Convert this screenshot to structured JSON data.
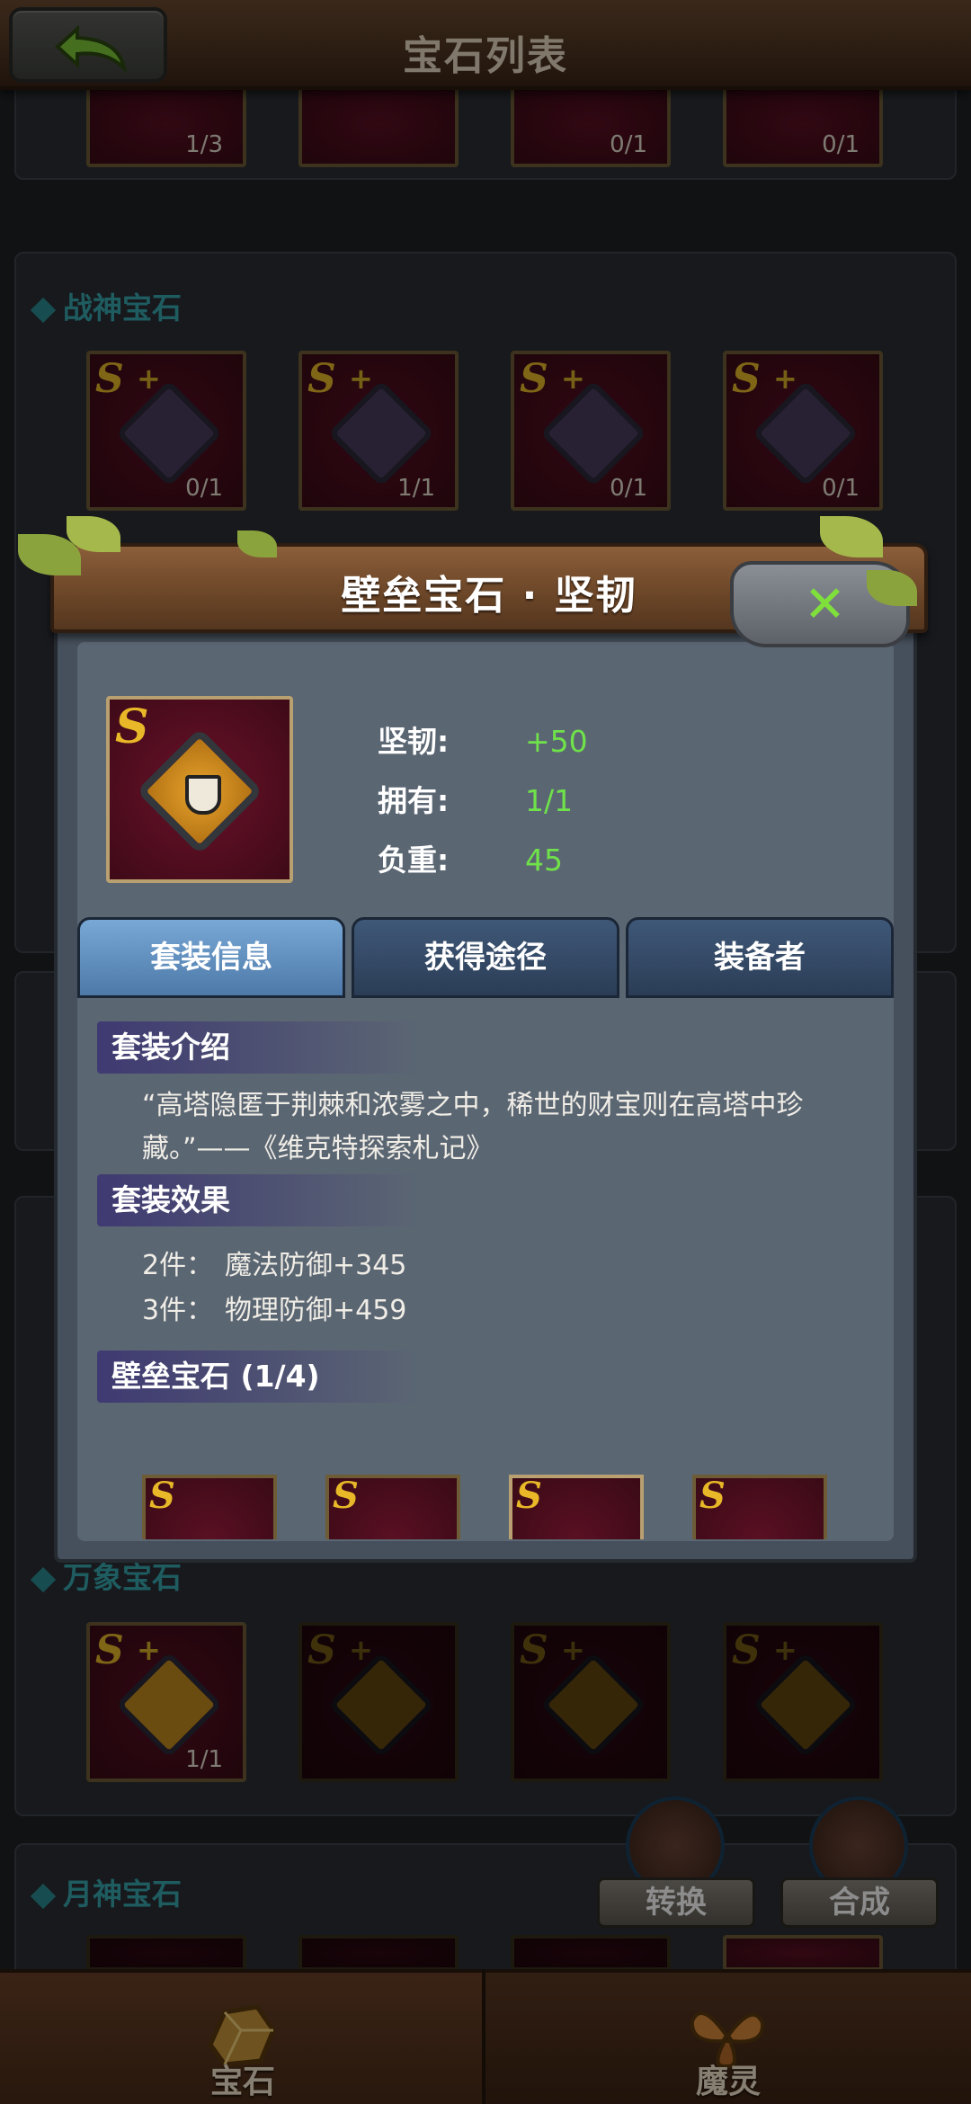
{
  "header": {
    "title": "宝石列表"
  },
  "background_sections": {
    "top_counts": [
      "1/3",
      "",
      "0/1",
      "0/1"
    ],
    "zhanshen": {
      "title": "战神宝石",
      "counts": [
        "0/1",
        "1/1",
        "0/1",
        "0/1"
      ]
    },
    "wanxiang": {
      "title": "万象宝石",
      "counts": [
        "1/1",
        "",
        "",
        ""
      ]
    },
    "yueshen": {
      "title": "月神宝石"
    }
  },
  "modal": {
    "title": "壁垒宝石 · 坚韧",
    "item": {
      "grade": "S"
    },
    "stats": [
      {
        "label": "坚韧:",
        "value": "+50"
      },
      {
        "label": "拥有:",
        "value": "1/1"
      },
      {
        "label": "负重:",
        "value": "45"
      }
    ],
    "tabs": [
      "套装信息",
      "获得途径",
      "装备者"
    ],
    "active_tab": 0,
    "set_intro": {
      "heading": "套装介绍",
      "text": "“高塔隐匿于荆棘和浓雾之中，稀世的财宝则在高塔中珍藏。”——《维克特探索札记》"
    },
    "set_effect": {
      "heading": "套装效果",
      "effects": [
        {
          "pieces": "2件：",
          "bonus": "魔法防御+345"
        },
        {
          "pieces": "3件：",
          "bonus": "物理防御+459"
        }
      ]
    },
    "set_members": {
      "heading": "壁垒宝石 (1/4)"
    }
  },
  "actions": {
    "convert": "转换",
    "synthesize": "合成"
  },
  "bottom_nav": {
    "items": [
      "宝石",
      "魔灵"
    ],
    "active": 0
  },
  "colors": {
    "stat_value": "#6fe24a",
    "section_title": "#38a8b0",
    "active_tab": "#78a8d6"
  }
}
